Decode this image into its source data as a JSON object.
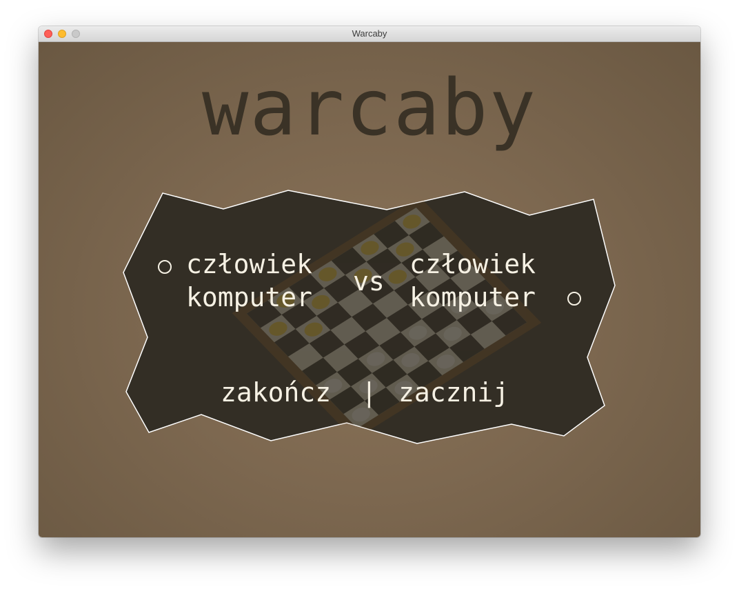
{
  "window": {
    "title": "Warcaby"
  },
  "game": {
    "title": "warcaby"
  },
  "menu": {
    "left_player": {
      "option_human": "człowiek",
      "option_computer": "komputer"
    },
    "versus_label": "vs",
    "right_player": {
      "option_human": "człowiek",
      "option_computer": "komputer"
    },
    "quit_label": "zakończ",
    "separator": "|",
    "start_label": "zacznij"
  },
  "colors": {
    "background": "#7d6850",
    "title_text": "#3a3226",
    "panel_fill": "#332e25",
    "panel_outline": "#ffffff",
    "menu_text": "#f6f1e4"
  }
}
